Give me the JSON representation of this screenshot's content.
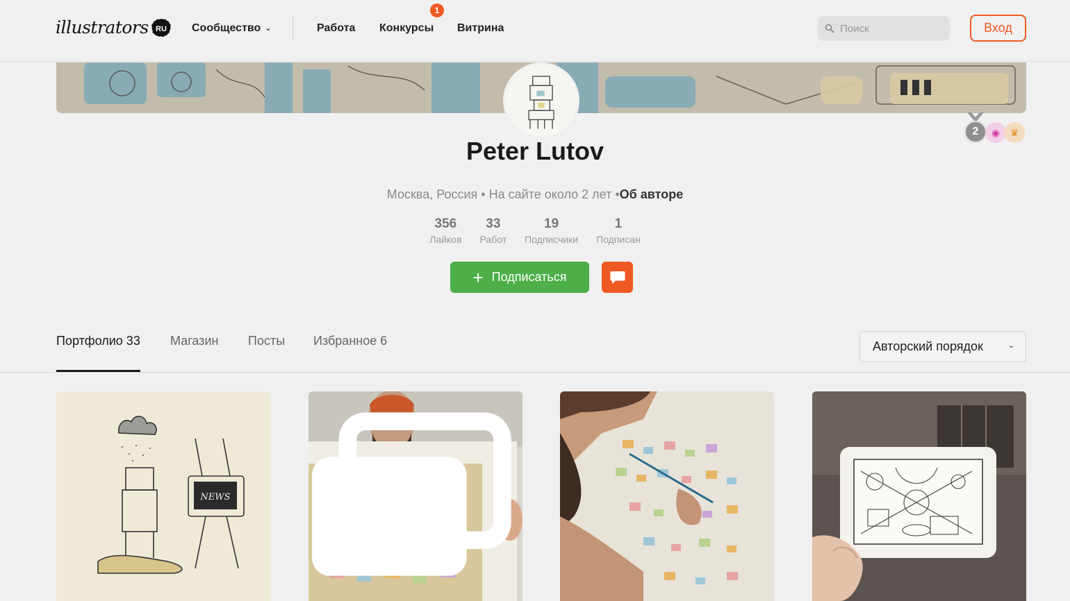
{
  "header": {
    "logo_text": "illustrators",
    "logo_suffix": "RU",
    "nav": [
      {
        "label": "Сообщество",
        "has_dropdown": true
      },
      {
        "label": "Работа"
      },
      {
        "label": "Конкурсы",
        "badge": "1"
      },
      {
        "label": "Витрина"
      }
    ],
    "search": {
      "placeholder": "Поиск",
      "value": ""
    },
    "login_label": "Вход"
  },
  "profile": {
    "name": "Peter Lutov",
    "location": "Москва, Россия",
    "on_site": "На сайте около 2 лет",
    "about_label": "Об авторе",
    "separator": "•",
    "medal_number": "2",
    "stats": [
      {
        "value": "356",
        "label": "Лайков"
      },
      {
        "value": "33",
        "label": "Работ"
      },
      {
        "value": "19",
        "label": "Подписчики"
      },
      {
        "value": "1",
        "label": "Подписан"
      }
    ],
    "subscribe_label": "Подписаться"
  },
  "tabs": [
    {
      "label": "Портфолио 33",
      "active": true
    },
    {
      "label": "Магазин",
      "active": false
    },
    {
      "label": "Посты",
      "active": false
    },
    {
      "label": "Избранное 6",
      "active": false
    }
  ],
  "sort": {
    "selected": "Авторский порядок"
  },
  "colors": {
    "accent": "#ef5a24",
    "success": "#4caf48",
    "background": "#f0f0f0"
  },
  "icons": {
    "search": "search-icon",
    "chevron": "chevron-down-icon",
    "plus": "plus-icon",
    "message": "message-icon",
    "multi_image": "gallery-icon"
  },
  "artwork": {
    "news_tv_text": "NEWS"
  }
}
